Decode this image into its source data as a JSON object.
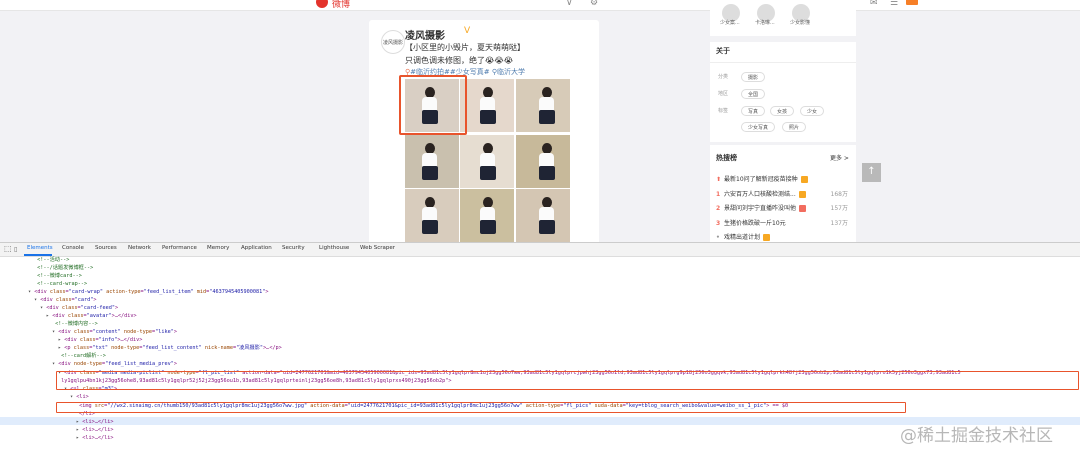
{
  "topbar": {
    "logo_text": "微博",
    "icons": [
      "chevron-icon",
      "gear-icon",
      "home-icon",
      "message-icon",
      "more-icon"
    ]
  },
  "sidebar_users": [
    {
      "label": "少女案..."
    },
    {
      "label": "卡洛琳..."
    },
    {
      "label": "少女影懂"
    }
  ],
  "card": {
    "avatar_text": "凌风摄影",
    "nick": "凌风摄影",
    "vip_icon": "v-badge-icon",
    "text_line1": "【小区里的小毁片，夏天萌萌哒】",
    "text_line2": "只调色调未修图，绝了😭😭😭",
    "topic1": "#临沂约拍#",
    "topic2": "#少女写真#",
    "location": "临沂大学"
  },
  "about": {
    "title": "关于",
    "rows": [
      {
        "key": "分类",
        "tags": [
          "摄影"
        ]
      },
      {
        "key": "地区",
        "tags": [
          "全国"
        ]
      },
      {
        "key": "标签",
        "tags": [
          "写真",
          "女孩",
          "少女"
        ]
      },
      {
        "key": "",
        "tags": [
          "少女写真",
          "照片"
        ]
      }
    ]
  },
  "hot": {
    "title": "热搜榜",
    "more": "更多 >",
    "items": [
      {
        "rank": "",
        "title": "最新10问了解新冠疫苗接种",
        "badge_color": "#f7a823",
        "num": ""
      },
      {
        "rank": "1",
        "title": "六安百万人口核酸检测结...",
        "badge_color": "#f7a823",
        "num": "168万"
      },
      {
        "rank": "2",
        "title": "景甜问刘宇宁直播咋没叫他",
        "badge_color": "#f26d5f",
        "num": "157万"
      },
      {
        "rank": "3",
        "title": "生猪价格跌破一斤10元",
        "badge_color": "",
        "num": "137万"
      },
      {
        "rank": "•",
        "title": "戏精出道计划",
        "badge_color": "#f7a823",
        "num": ""
      }
    ]
  },
  "scroll_top": "↑",
  "devtools": {
    "tabs": [
      "Elements",
      "Console",
      "Sources",
      "Network",
      "Performance",
      "Memory",
      "Application",
      "Security",
      "Lighthouse",
      "Web Scraper"
    ],
    "active_tab": "Elements",
    "lines": [
      "<!--活动-->",
      "<!--/话题发微博框-->",
      "<!--微博card-->",
      "<!--card-wrap-->",
      "<div class=\"card-wrap\" action-type=\"feed_list_item\" mid=\"4637945405900081\">",
      "<div class=\"card\">",
      "<div class=\"card-feed\">",
      "<div class=\"avatar\">…</div>",
      "<!--微博内容-->",
      "<div class=\"content\" node-type=\"like\">",
      "<div class=\"info\">…</div>",
      "<p class=\"txt\" node-type=\"feed_list_content\" nick-name=\"凌风摄影\">…</p>",
      "<!--card解析-->",
      "<div node-type=\"feed_list_media_prev\">",
      "<div class=\"media media-piclist\" node-type=\"fl_pic_list\" action-data=\"uid=2477621701&mid=4637945405900081&pic_ids=93ad81c5ly1gqlpr8mc1uj23gg56o7ww,93ad81c5ly1gqlprcjpwhj23gg56o1ld,93ad81c5ly1gqlprg9p18j256o3ggqvk,93ad81c5ly1gqlprkh48fj23gg56ob2p,93ad81c5ly1gqlpro1k5yj256o3ggx73,93ad81c5",
      "ly1gqlpu4bn1kj23gg56ohe8,93ad81c5ly1gqlpr52j52j23gg56ou1b,93ad81c5ly1gqlprteinlj23gg56oe8h,93ad81c5ly1gqlprxs490j23gg56ob2p\">",
      "<ul class=\"m3\">",
      "<li>",
      "<img src=\"//wx2.sinaimg.cn/thumb150/93ad81c5ly1gqlpr8mc1uj23gg56o7ww.jpg\" action-data=\"uid=2477621701&pic_id=93ad81c5ly1gqlpr8mc1uj23gg56o7ww\" action-type=\"fl_pics\" suda-data=\"key=tblog_search_weibo&value=weibo_ss_1_pic\"> == $0",
      "</li>",
      "<li>…</li>",
      "<li>…</li>",
      "<li>…</li>"
    ]
  },
  "watermark": "@稀土掘金技术社区"
}
